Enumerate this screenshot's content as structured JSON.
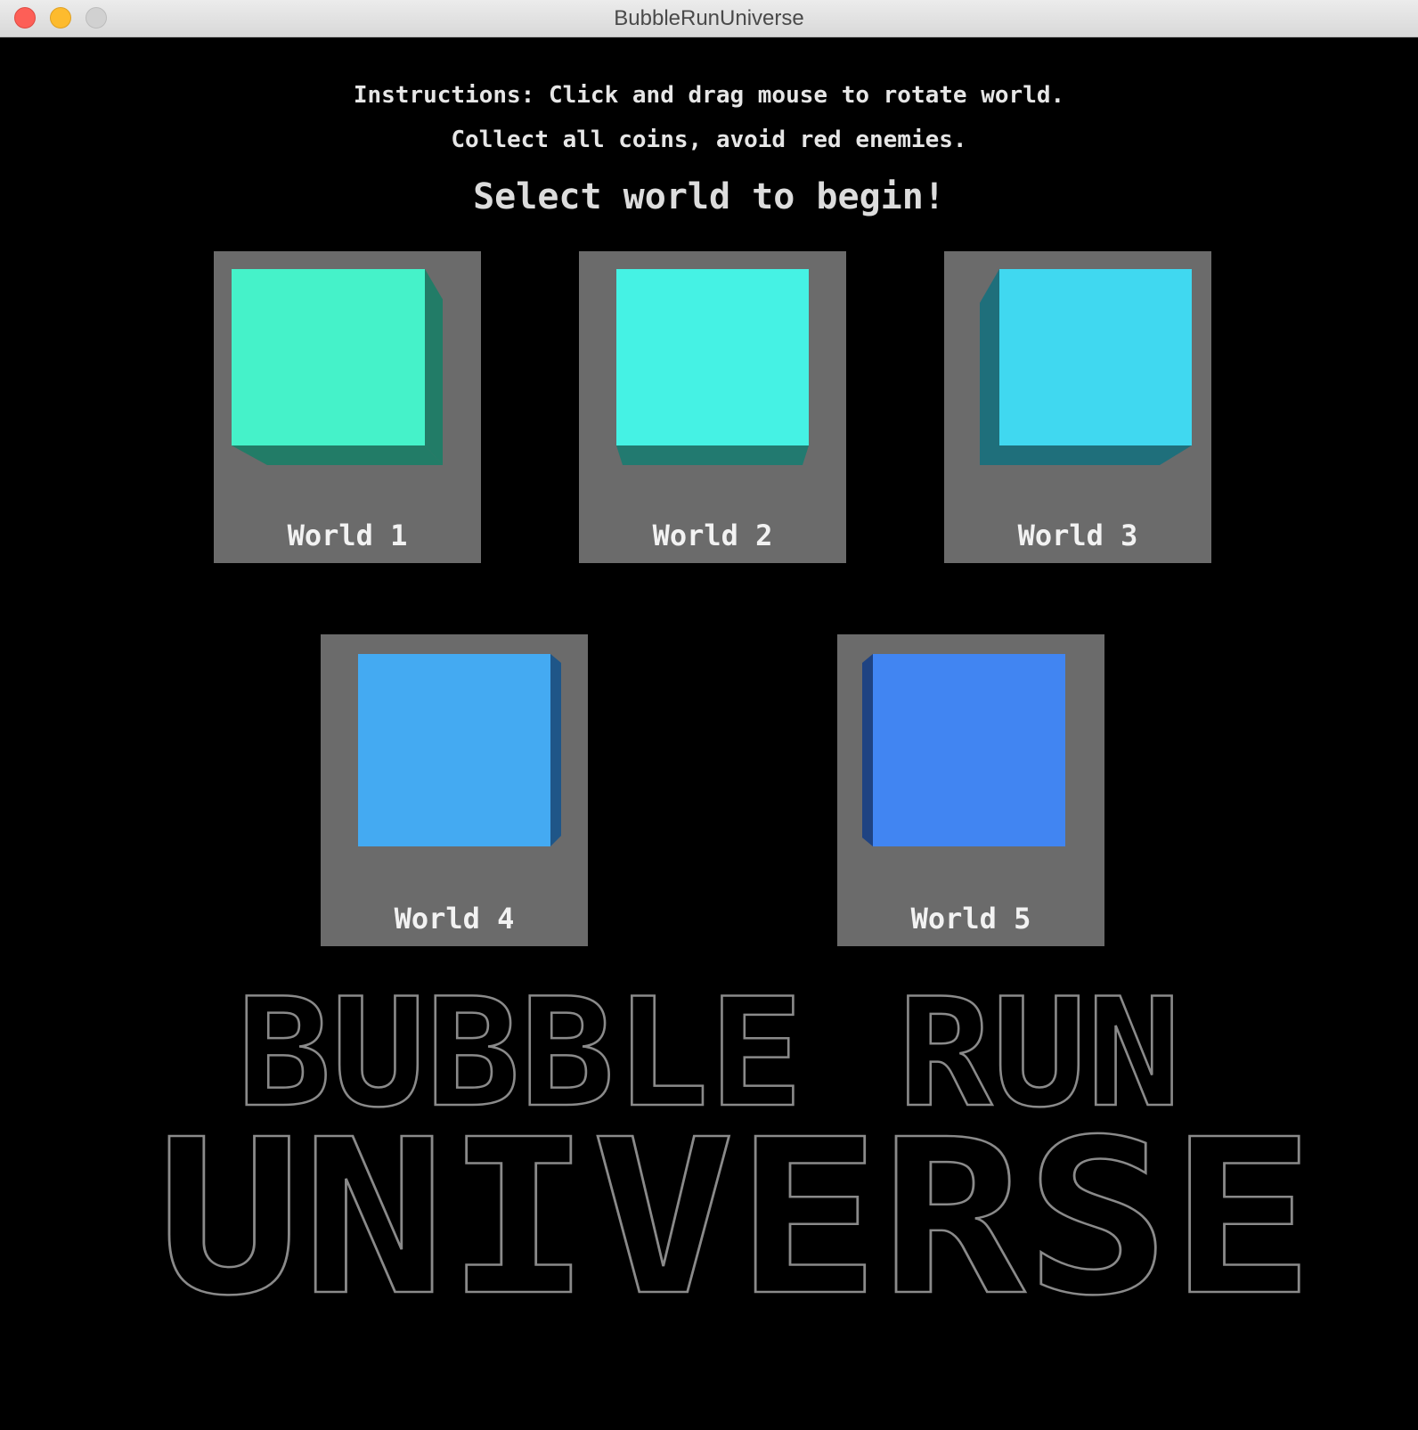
{
  "window": {
    "title": "BubbleRunUniverse"
  },
  "menu": {
    "instructions_line1": "Instructions: Click and drag mouse to rotate world.",
    "instructions_line2": "Collect all coins, avoid red enemies.",
    "headline": "Select world to begin!"
  },
  "worlds": [
    {
      "label": "World 1",
      "color": "#45f2c9",
      "shade": "#227c67",
      "icon": "cube-icon"
    },
    {
      "label": "World 2",
      "color": "#45f2e4",
      "shade": "#227a70",
      "icon": "cube-icon"
    },
    {
      "label": "World 3",
      "color": "#40d8f0",
      "shade": "#1f6f7b",
      "icon": "cube-icon"
    },
    {
      "label": "World 4",
      "color": "#44aaf2",
      "shade": "#1f5688",
      "icon": "cube-icon"
    },
    {
      "label": "World 5",
      "color": "#4185f2",
      "shade": "#1f4382",
      "icon": "cube-icon"
    }
  ],
  "logo": {
    "line1": "BUBBLE RUN",
    "line2": "UNIVERSE"
  }
}
